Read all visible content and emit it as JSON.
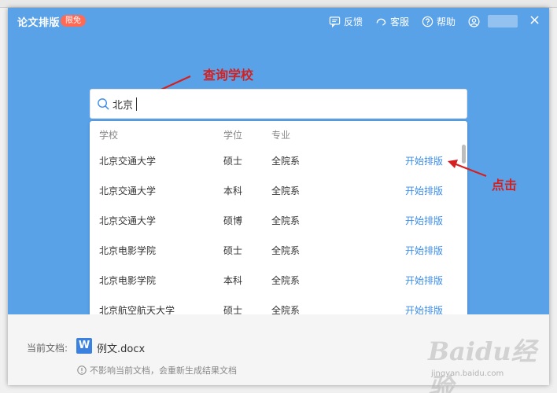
{
  "window": {
    "title": "论文排版",
    "badge": "限免"
  },
  "header": {
    "feedback_label": "反馈",
    "service_label": "客服",
    "help_label": "帮助",
    "close_symbol": "×"
  },
  "annotations": {
    "query_label": "查询学校",
    "click_label": "点击"
  },
  "search": {
    "value": "北京"
  },
  "results": {
    "columns": {
      "school": "学校",
      "degree": "学位",
      "major": "专业"
    },
    "rows": [
      {
        "school": "北京交通大学",
        "degree": "硕士",
        "major": "全院系",
        "action": "开始排版"
      },
      {
        "school": "北京交通大学",
        "degree": "本科",
        "major": "全院系",
        "action": "开始排版"
      },
      {
        "school": "北京交通大学",
        "degree": "硕博",
        "major": "全院系",
        "action": "开始排版"
      },
      {
        "school": "北京电影学院",
        "degree": "硕士",
        "major": "全院系",
        "action": "开始排版"
      },
      {
        "school": "北京电影学院",
        "degree": "本科",
        "major": "全院系",
        "action": "开始排版"
      },
      {
        "school": "北京航空航天大学",
        "degree": "硕士",
        "major": "全院系",
        "action": "开始排版"
      }
    ]
  },
  "current_doc": {
    "label": "当前文档:",
    "icon_letter": "W",
    "filename": "例文.docx",
    "note": "不影响当前文档，会重新生成结果文档"
  },
  "watermark": {
    "main": "Baidu经验",
    "sub": "jingyan.baidu.com"
  },
  "colors": {
    "header_blue": "#5aa2e8",
    "badge": "#ff6a57",
    "link_blue": "#3d8ee8",
    "annotation_red": "#d42020"
  }
}
